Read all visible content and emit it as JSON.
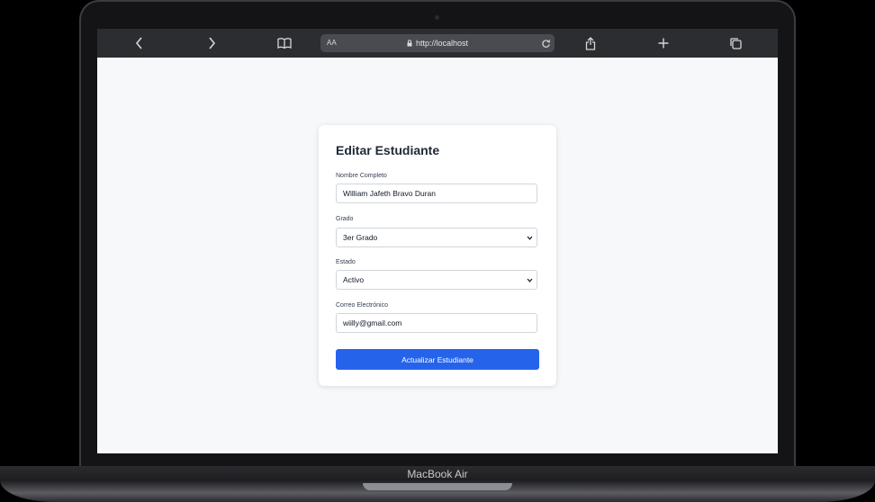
{
  "browser": {
    "url": "http://localhost",
    "reader_label": "AA",
    "icons": [
      "back-icon",
      "forward-icon",
      "bookmarks-icon",
      "lock-icon",
      "reload-icon",
      "share-icon",
      "new-tab-icon",
      "tabs-icon"
    ]
  },
  "device": {
    "label": "MacBook Air"
  },
  "form": {
    "title": "Editar Estudiante",
    "name_label": "Nombre Completo",
    "name_value": "William Jafeth Bravo Duran",
    "grade_label": "Grado",
    "grade_value": "3er Grado",
    "status_label": "Estado",
    "status_value": "Activo",
    "email_label": "Correo Electrónico",
    "email_value": "wiilly@gmail.com",
    "submit_label": "Actualizar Estudiante"
  },
  "colors": {
    "primary_button": "#2563eb",
    "page_background": "#f7f8fa",
    "toolbar": "#2c2d31"
  }
}
